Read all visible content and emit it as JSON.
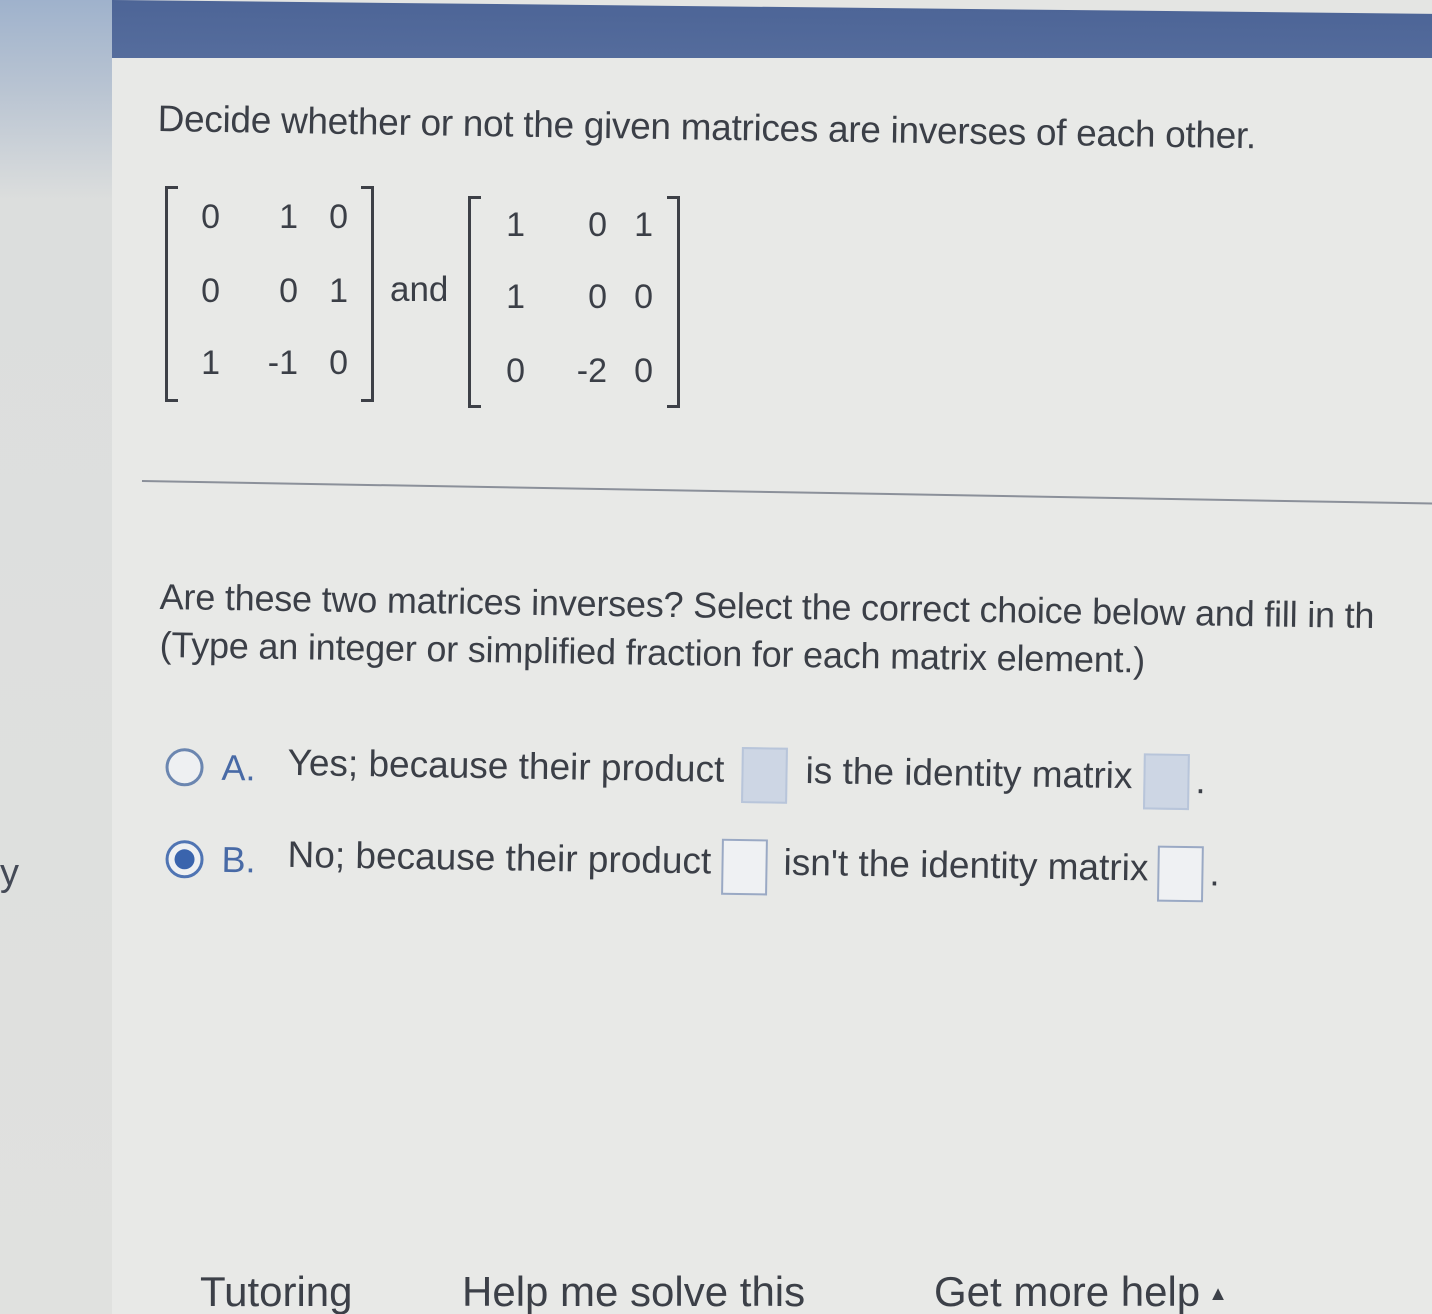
{
  "sidebar": {
    "fragment_text": "y"
  },
  "question": {
    "title": "Decide whether or not the given matrices are inverses of each other.",
    "connector": "and",
    "matrix_a": [
      [
        "0",
        "1",
        "0"
      ],
      [
        "0",
        "0",
        "1"
      ],
      [
        "1",
        "-1",
        "0"
      ]
    ],
    "matrix_b": [
      [
        "1",
        "0",
        "1"
      ],
      [
        "1",
        "0",
        "0"
      ],
      [
        "0",
        "-2",
        "0"
      ]
    ]
  },
  "prompt": {
    "line1": "Are these two matrices inverses? Select the correct choice below and fill in th",
    "line2": "(Type an integer or simplified fraction for each matrix element.)"
  },
  "choices": {
    "a": {
      "letter": "A.",
      "text1": "Yes; because their product",
      "text2": "is the identity matrix",
      "period": ".",
      "selected": false
    },
    "b": {
      "letter": "B.",
      "text1": "No; because their product",
      "text2": "isn't the identity matrix",
      "period": ".",
      "selected": true
    }
  },
  "help_bar": {
    "tutoring": "Tutoring",
    "help_me_solve": "Help me solve this",
    "get_more_help": "Get more help",
    "caret": "▲"
  },
  "colors": {
    "header": "#4d6597",
    "accent": "#486aa6",
    "background": "#e8e9e7"
  }
}
